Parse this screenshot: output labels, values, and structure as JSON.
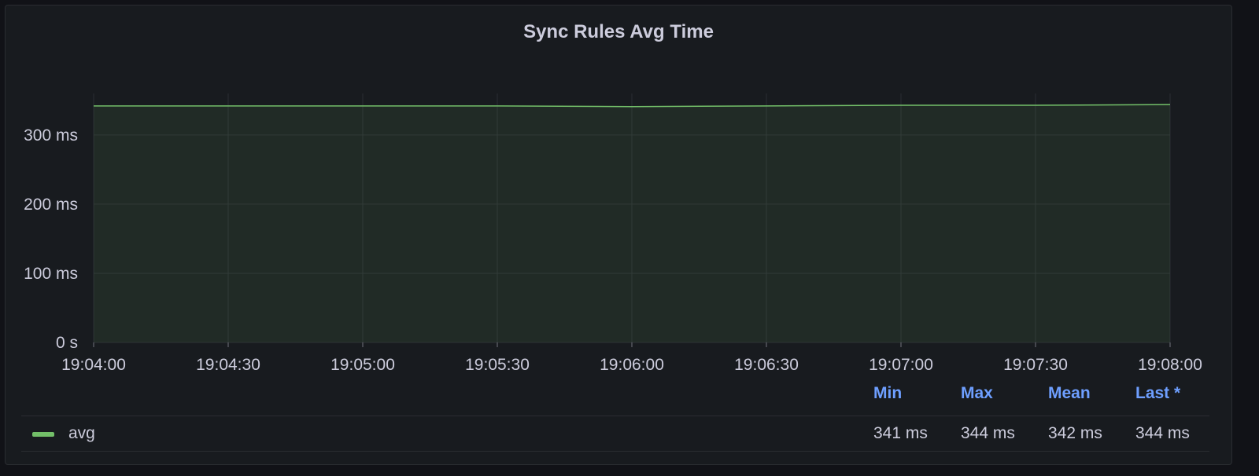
{
  "panel": {
    "title": "Sync Rules Avg Time"
  },
  "chart_data": {
    "type": "line",
    "title": "Sync Rules Avg Time",
    "xlabel": "",
    "ylabel": "",
    "x": [
      "19:04:00",
      "19:04:30",
      "19:05:00",
      "19:05:30",
      "19:06:00",
      "19:06:30",
      "19:07:00",
      "19:07:30",
      "19:08:00"
    ],
    "series": [
      {
        "name": "avg",
        "values": [
          342,
          342,
          342,
          342,
          341,
          342,
          343,
          343,
          344
        ],
        "color": "#73bf69"
      }
    ],
    "ylim": [
      0,
      360
    ],
    "y_ticks": [
      0,
      100,
      200,
      300
    ],
    "y_tick_labels": [
      "0 s",
      "100 ms",
      "200 ms",
      "300 ms"
    ],
    "x_tick_labels": [
      "19:04:00",
      "19:04:30",
      "19:05:00",
      "19:05:30",
      "19:06:00",
      "19:06:30",
      "19:07:00",
      "19:07:30",
      "19:08:00"
    ],
    "grid": true,
    "fill_area": true
  },
  "legend": {
    "headers": {
      "min": "Min",
      "max": "Max",
      "mean": "Mean",
      "last": "Last *"
    },
    "rows": [
      {
        "name": "avg",
        "min": "341 ms",
        "max": "344 ms",
        "mean": "342 ms",
        "last": "344 ms",
        "color": "#73bf69"
      }
    ]
  },
  "colors": {
    "background": "#181b1f",
    "grid": "#2a2d33",
    "text": "#ccccdc",
    "accent": "#6e9fff",
    "series": "#73bf69"
  }
}
